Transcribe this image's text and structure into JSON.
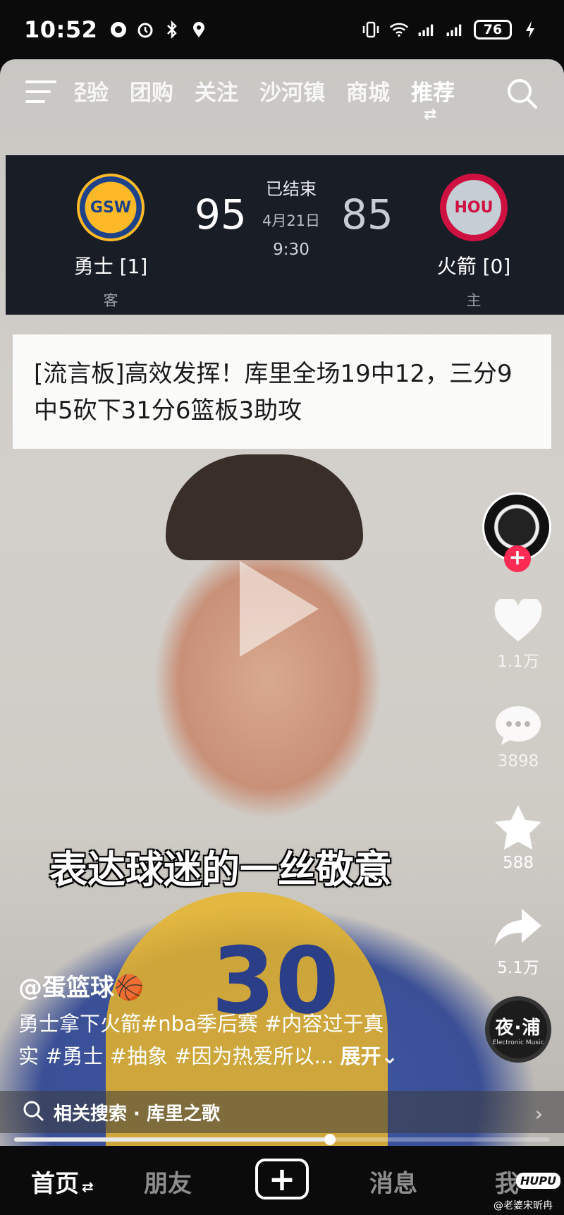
{
  "status_bar": {
    "time": "10:52",
    "battery": "76"
  },
  "top_nav": {
    "tabs": [
      {
        "label": "经验",
        "active": false
      },
      {
        "label": "团购",
        "active": false
      },
      {
        "label": "关注",
        "active": false
      },
      {
        "label": "沙河镇",
        "active": false
      },
      {
        "label": "商城",
        "active": false
      },
      {
        "label": "推荐",
        "active": true
      }
    ],
    "swap_glyph": "⇄"
  },
  "score": {
    "away": {
      "abbr": "GSW",
      "name": "勇士 [1]",
      "side": "客",
      "points": "95"
    },
    "home": {
      "abbr": "HOU",
      "name": "火箭 [0]",
      "side": "主",
      "points": "85"
    },
    "status": "已结束",
    "date": "4月21日",
    "time": "9:30"
  },
  "headline": "[流言板]高效发挥！库里全场19中12，三分9中5砍下31分6篮板3助攻",
  "video": {
    "jersey_number": "30",
    "subtitle": "表达球迷的一丝敬意",
    "progress_percent": 59
  },
  "actions": {
    "like_count": "1.1万",
    "comment_count": "3898",
    "favorite_count": "588",
    "share_count": "5.1万",
    "follow_label": "+"
  },
  "music": {
    "title": "夜·浦",
    "subtitle": "Electronic Music"
  },
  "caption": {
    "author": "@蛋篮球🏀",
    "line1": "勇士拿下火箭#nba季后赛 #内容过于真",
    "line2": "实 #勇士 #抽象 #因为热爱所以...",
    "expand": "展开⌄"
  },
  "related_search": {
    "label": "相关搜索 · 库里之歌"
  },
  "bottom_nav": {
    "home": "首页",
    "home_swap": "⇄",
    "friends": "朋友",
    "plus": "+",
    "messages": "消息",
    "me": "我"
  },
  "watermark": {
    "logo": "HUPU",
    "credit": "@老婆宋昕冉"
  },
  "colors": {
    "follow_red": "#fe2c55",
    "warriors_gold": "#fdb927",
    "warriors_blue": "#1d428a",
    "rockets_red": "#ce1141",
    "banner_bg": "#181d26"
  }
}
